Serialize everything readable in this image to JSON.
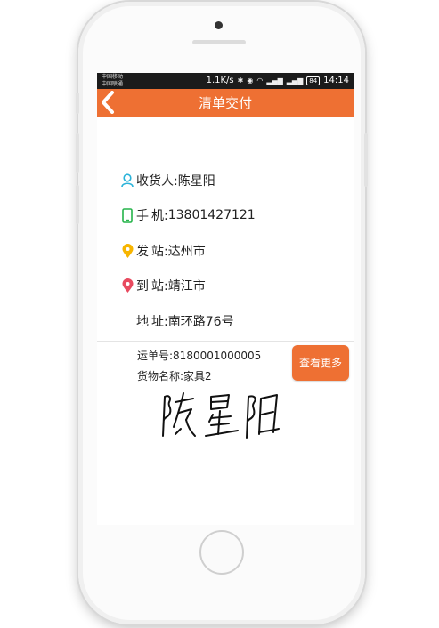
{
  "statusbar": {
    "carrier1": "中国移动",
    "carrier2": "中国联通",
    "speed": "1.1K/s",
    "battery": "84",
    "time": "14:14"
  },
  "header": {
    "title": "清单交付"
  },
  "recipient": {
    "label": "收货人:",
    "value": "陈星阳"
  },
  "phone": {
    "label_a": "手",
    "label_b": "机:",
    "value": "13801427121"
  },
  "origin": {
    "label_a": "发",
    "label_b": "站:",
    "value": "达州市"
  },
  "destination": {
    "label_a": "到",
    "label_b": "站:",
    "value": "靖江市"
  },
  "address": {
    "label_a": "地",
    "label_b": "址:",
    "value": "南环路76号"
  },
  "waybill": {
    "label": "运单号:",
    "value": "8180001000005"
  },
  "goods": {
    "label": "货物名称:",
    "value": "家具2"
  },
  "actions": {
    "more_label": "查看更多"
  },
  "signature": {
    "text": "陈星阳"
  },
  "colors": {
    "accent": "#ee7033",
    "person_icon": "#2bb3d9",
    "phone_icon": "#25b44a",
    "origin_icon": "#f7b500",
    "dest_icon": "#e84a5f"
  }
}
